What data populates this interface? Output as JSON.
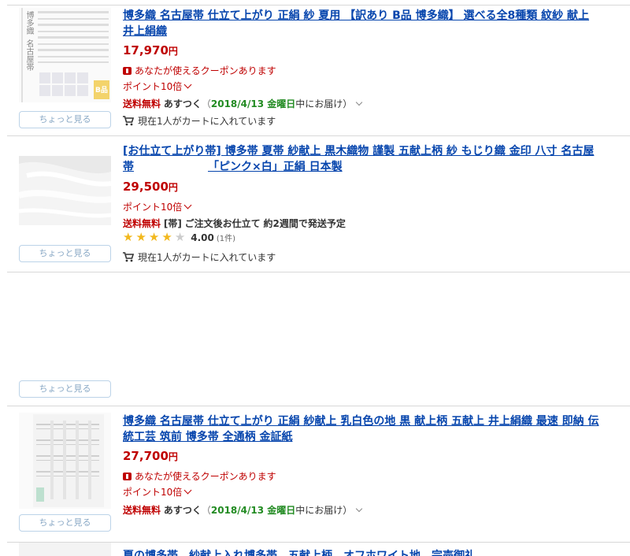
{
  "peek_label": "ちょっと見る",
  "items": [
    {
      "title_line1": "博多織 名古屋帯 仕立て上がり 正絹 紗 夏用 【訳あり B品 博多織】 選べる全8種類 紋紗 献上",
      "title_line2": "井上絹織",
      "price": "17,970",
      "yen": "円",
      "coupon": "あなたが使えるクーポンあります",
      "point": "ポイント10倍",
      "ship_free": "送料無料",
      "ship_method": "あすつく",
      "ship_open": "（",
      "ship_date": "2018/4/13 金曜日",
      "ship_tail": "中にお届け）",
      "cart": "現在1人がカートに入れています",
      "thumb_text_a": "博多織",
      "thumb_text_b": "名古屋帯",
      "thumb_badge": "B品"
    },
    {
      "title_line1": "[お仕立て上がり帯] 博多帯 夏帯 紗献上 黒木織物 謹製 五献上柄 紗 もじり織 金印 八寸 名古屋",
      "title_line2a": "帯",
      "title_line2b": "「ピンク×白」正絹 日本製",
      "price": "29,500",
      "yen": "円",
      "point": "ポイント10倍",
      "ship_free": "送料無料",
      "ship_bracket": "[帯]",
      "ship_msg": "ご注文後お仕立て",
      "ship_eta": "約2週間で発送予定",
      "rating_score": "4.00",
      "rating_count": "(1件)",
      "rating_value": 4,
      "cart": "現在1人がカートに入れています"
    },
    {
      "title_line1": "博多織 名古屋帯 仕立て上がり 正絹 紗献上 乳白色の地 黒 献上柄 五献上 井上絹織 最速 即納 伝",
      "title_line2": "統工芸 筑前 博多帯 全通柄 金証紙",
      "price": "27,700",
      "yen": "円",
      "coupon": "あなたが使えるクーポンあります",
      "point": "ポイント10倍",
      "ship_free": "送料無料",
      "ship_method": "あすつく",
      "ship_open": "（",
      "ship_date": "2018/4/13 金曜日",
      "ship_tail": "中にお届け）"
    },
    {
      "title_line1": "夏の博多帯　紗献上入れ博多帯　五献上柄　オフホワイト地　完売御礼"
    }
  ]
}
